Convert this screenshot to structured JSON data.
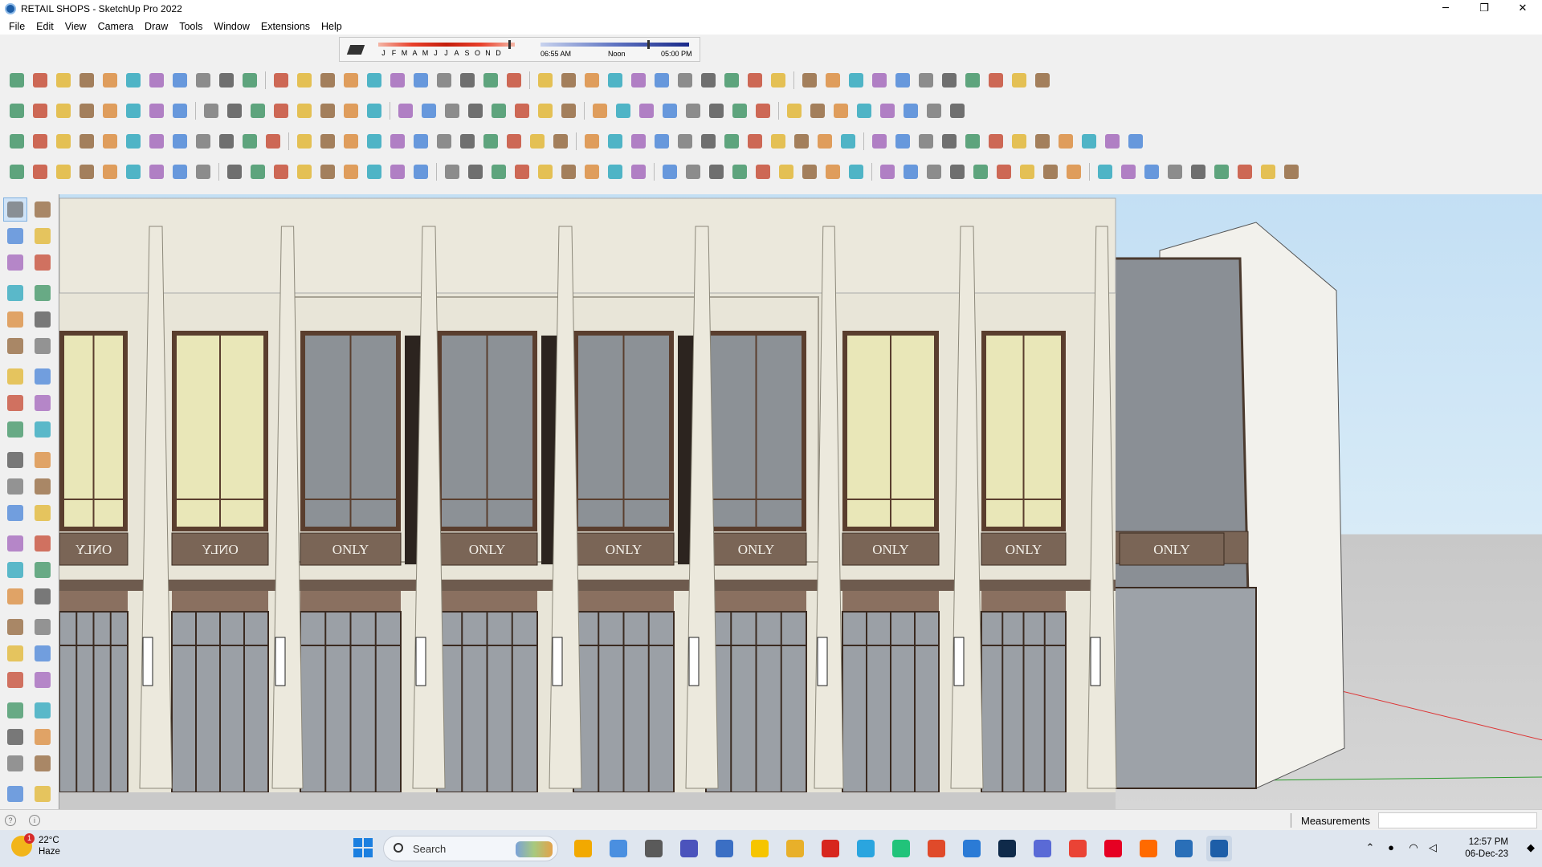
{
  "window": {
    "title": "RETAIL SHOPS - SketchUp Pro 2022",
    "controls": [
      "─",
      "❐",
      "✕"
    ]
  },
  "menu": [
    "File",
    "Edit",
    "View",
    "Camera",
    "Draw",
    "Tools",
    "Window",
    "Extensions",
    "Help"
  ],
  "shadows": {
    "months": [
      "J",
      "F",
      "M",
      "A",
      "M",
      "J",
      "J",
      "A",
      "S",
      "O",
      "N",
      "D"
    ],
    "sunrise": "06:55 AM",
    "noon": "Noon",
    "sunset": "05:00 PM",
    "month_fraction": 0.95,
    "time_fraction": 0.72
  },
  "model": {
    "storefront_signs": [
      "ONLY",
      "ONLY",
      "ONLY",
      "ONLY",
      "ONLY",
      "ONLY",
      "ONLY"
    ],
    "mirrored_signs": [
      "ONLY",
      "ONLY"
    ]
  },
  "statusbar": {
    "measurements_label": "Measurements",
    "measurements_value": ""
  },
  "taskbar": {
    "weather_temp": "22°C",
    "weather_desc": "Haze",
    "weather_badge": "1",
    "search_placeholder": "Search",
    "apps": [
      "file-explorer-icon",
      "copilot-icon",
      "task-view-icon",
      "teams-icon",
      "calculator-icon",
      "sticky-notes-icon",
      "folder-icon",
      "opera-icon",
      "telegram-icon",
      "pycharm-icon",
      "grammarly-icon",
      "vscode-icon",
      "photoshop-icon",
      "autodesk-icon",
      "chrome-icon",
      "pinterest-icon",
      "soundcloud-icon",
      "terminal-icon",
      "sketchup-icon"
    ],
    "time": "12:57 PM",
    "date": "06-Dec-23"
  },
  "colors": {
    "accent": "#1b7fe0",
    "facade": "#e8e5d8",
    "frame": "#5a3e2e",
    "glass": "#8c9196",
    "lit_glass": "#e9e7b8",
    "sign_band": "#7a6556"
  }
}
